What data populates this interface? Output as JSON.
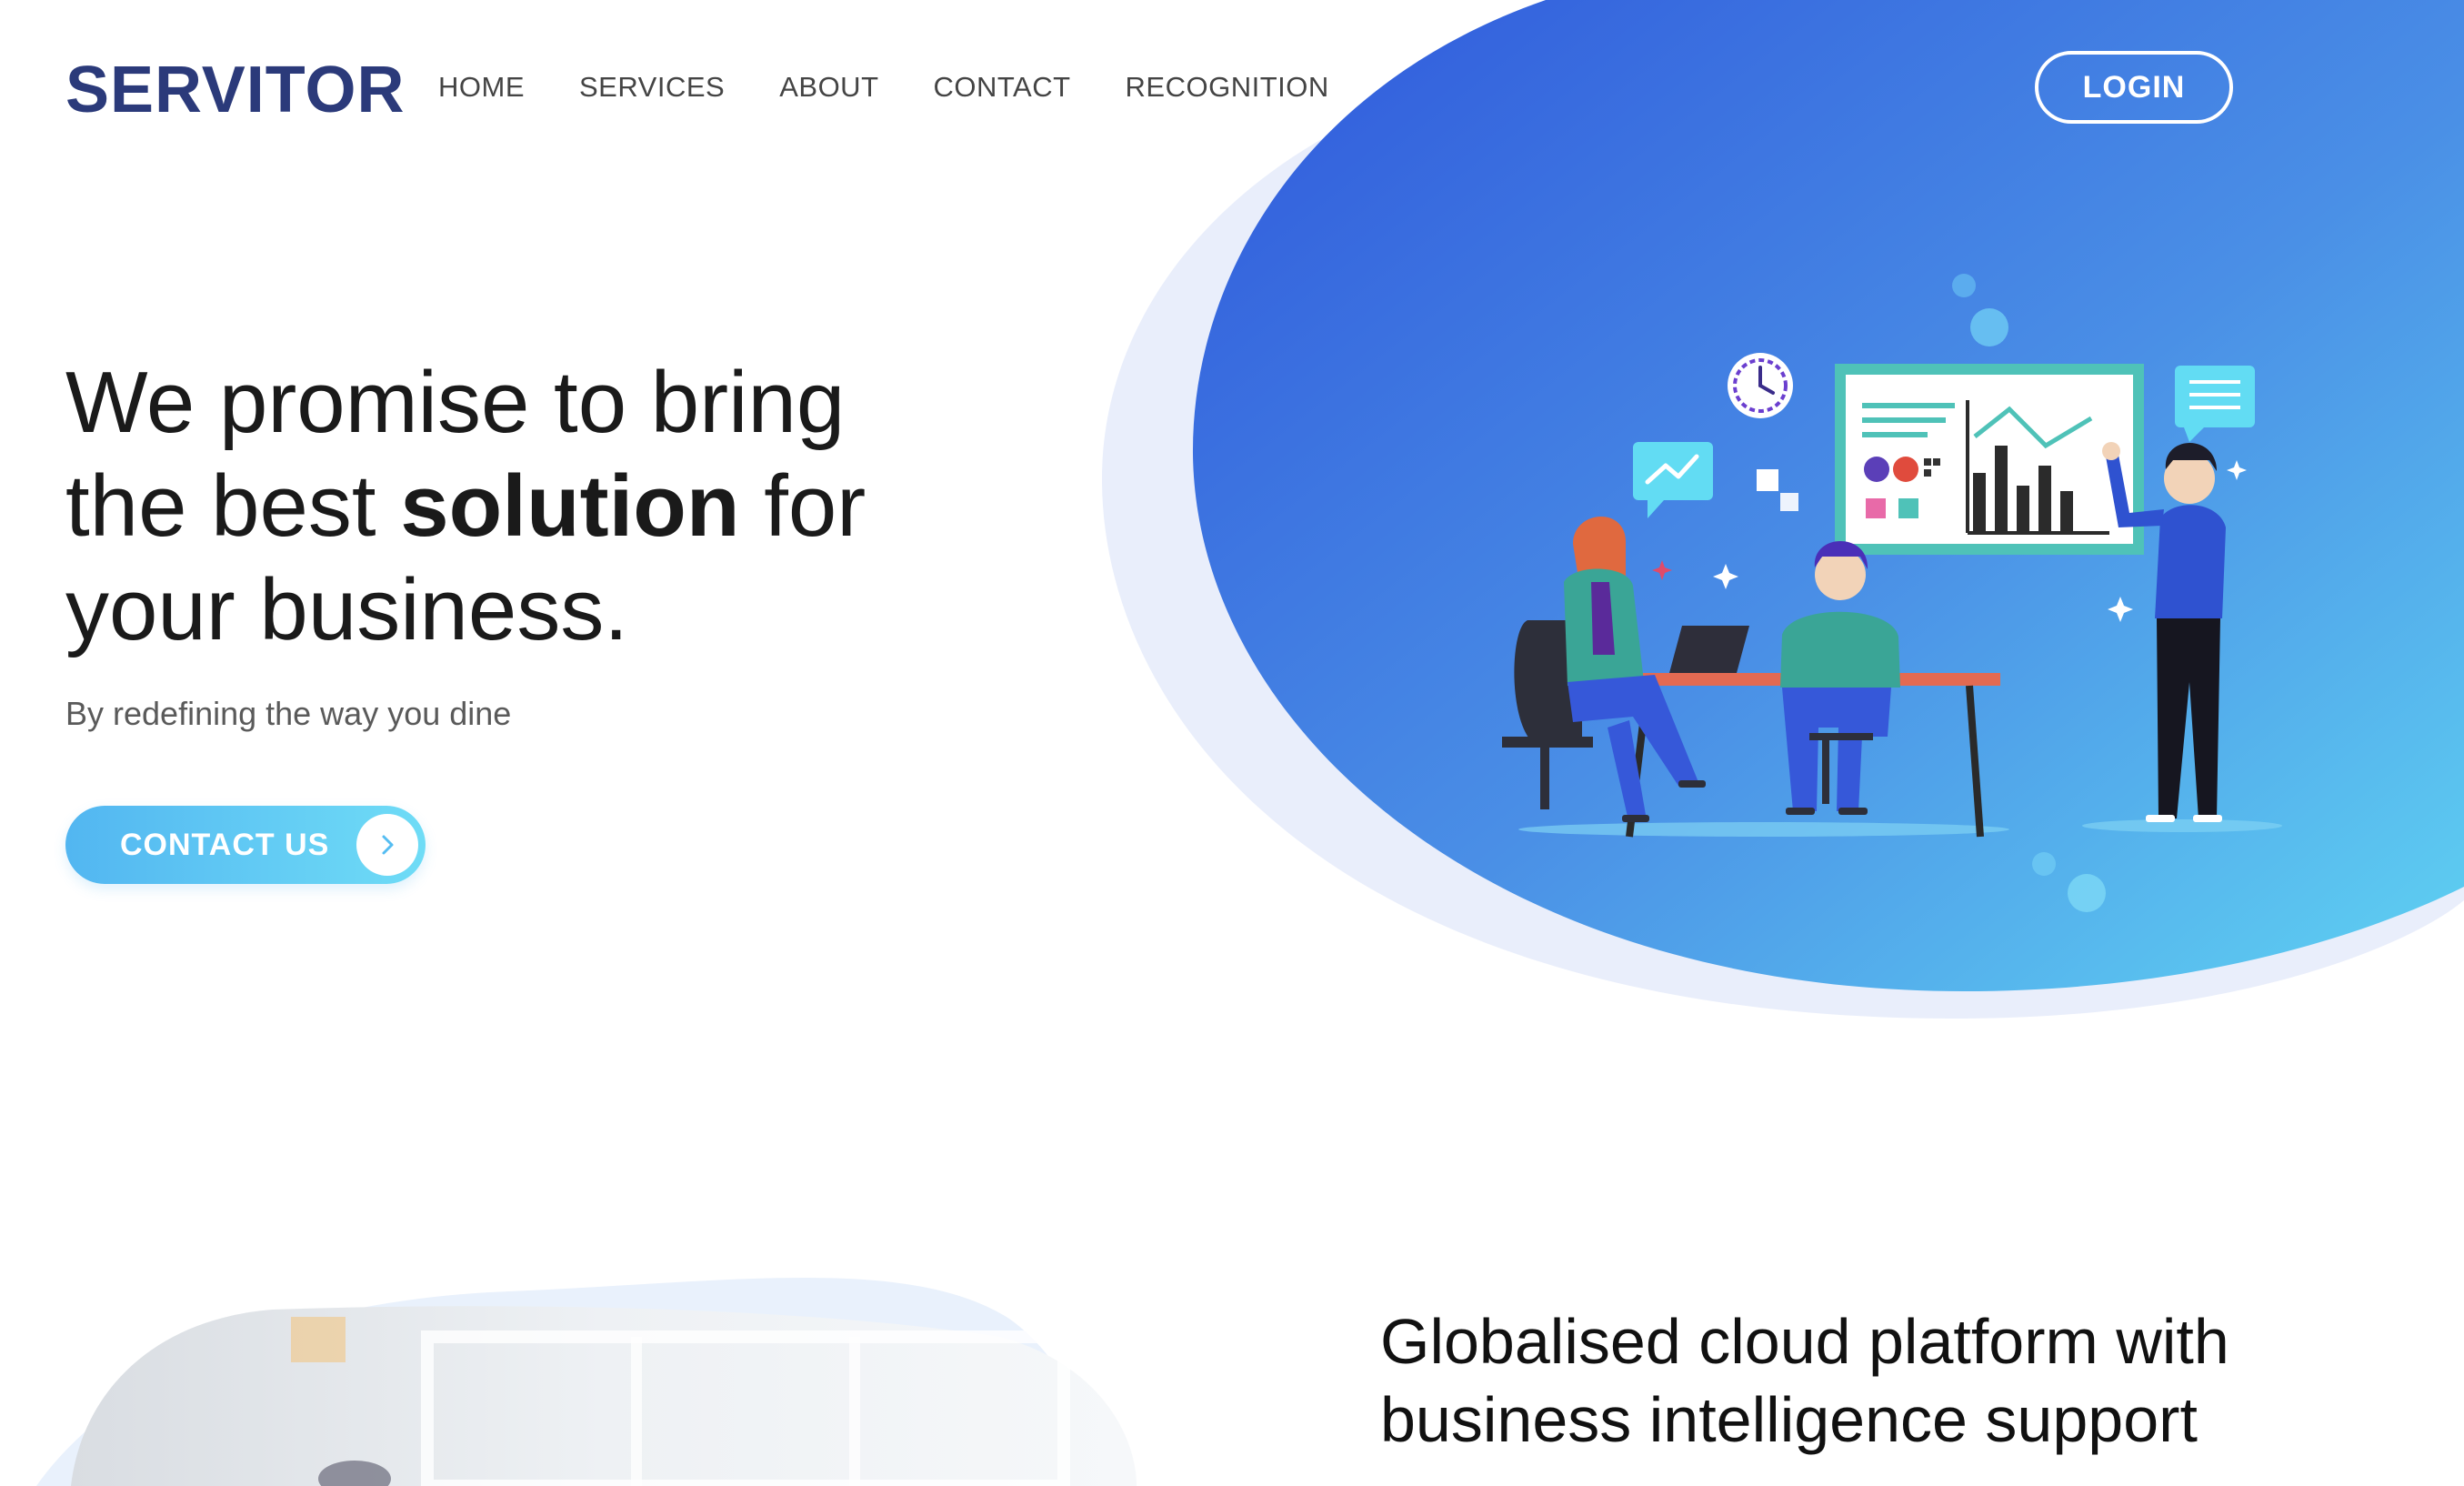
{
  "header": {
    "brand": "SERVITOR",
    "nav": [
      "HOME",
      "SERVICES",
      "ABOUT",
      "CONTACT",
      "RECOGNITION"
    ],
    "login_label": "LOGIN"
  },
  "hero": {
    "title_line1": "We promise to bring",
    "title_line2_pre": "the best ",
    "title_line2_bold": "solution",
    "title_line2_post": " for",
    "title_line3": "your business.",
    "subtitle": "By redefining the way you dine",
    "cta_label": "CONTACT US",
    "cta_icon": "chevron-right-icon"
  },
  "section2": {
    "title_line1": "Globalised cloud platform with",
    "title_line2": "business intelligence support"
  },
  "colors": {
    "brand": "#2b3a7a",
    "blob_start": "#2f5ddc",
    "blob_end": "#5ccaf0",
    "cta_start": "#52b6f1",
    "cta_end": "#6fdcf6"
  }
}
